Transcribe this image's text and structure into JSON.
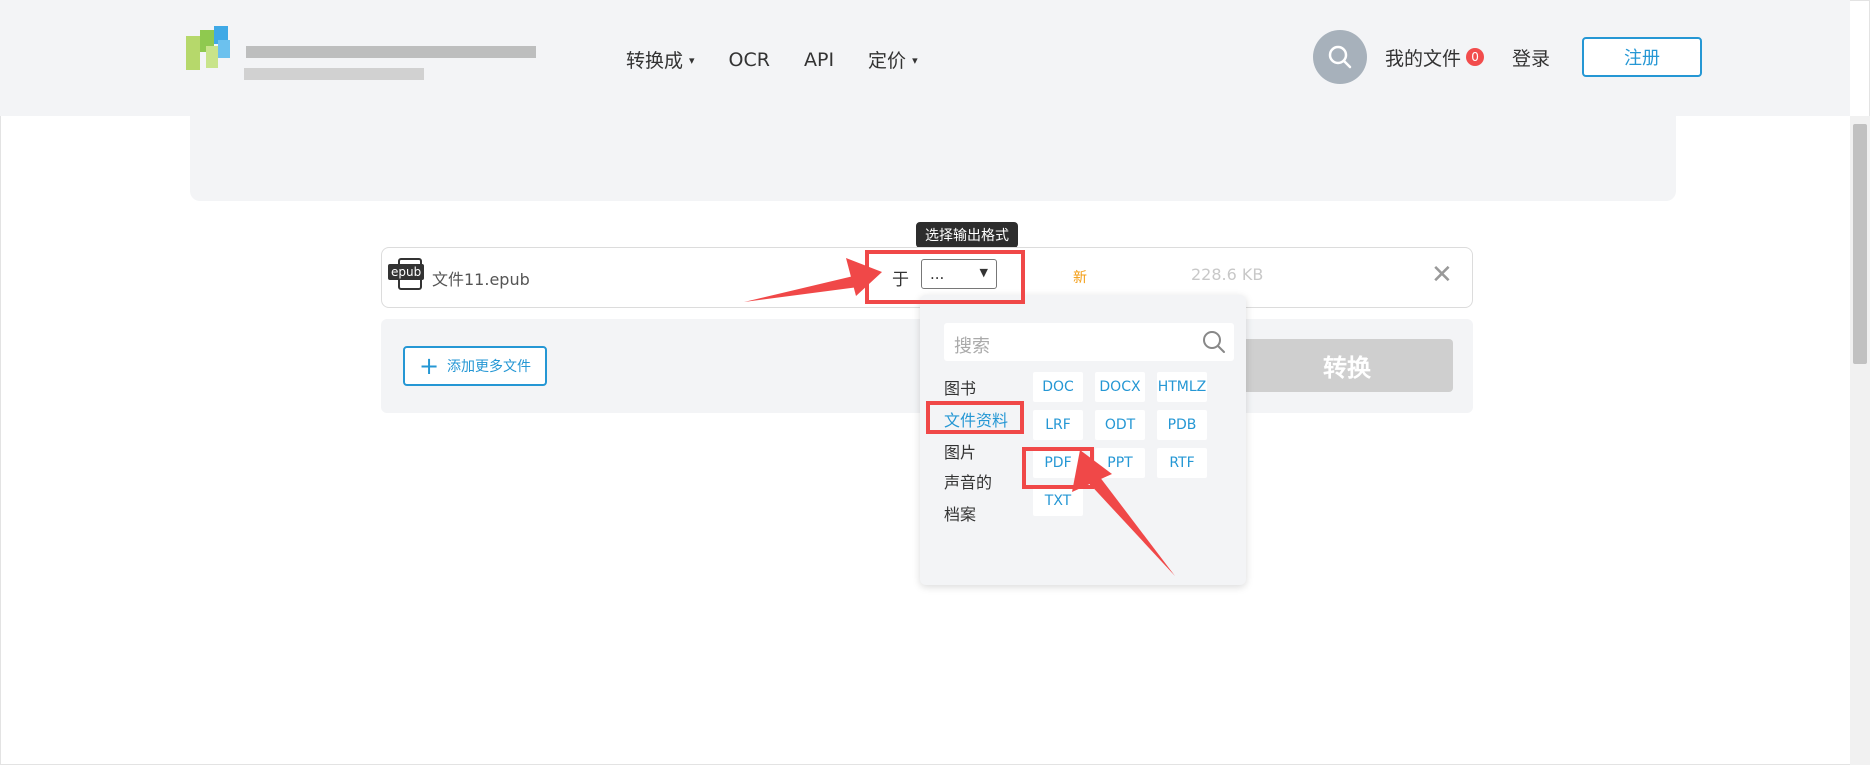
{
  "nav": {
    "items": [
      {
        "label": "转换成",
        "dropdown": true
      },
      {
        "label": "OCR",
        "dropdown": false
      },
      {
        "label": "API",
        "dropdown": false
      },
      {
        "label": "定价",
        "dropdown": true
      }
    ],
    "my_files": "我的文件",
    "my_files_count": "0",
    "login": "登录",
    "register": "注册"
  },
  "file": {
    "type_tag": "epub",
    "name": "文件11.epub",
    "to_label": "于",
    "selected_format": "...",
    "status": "新",
    "size": "228.6 KB",
    "remove": "✕"
  },
  "tooltip": "选择输出格式",
  "actions": {
    "add_more": "添加更多文件",
    "convert": "转换"
  },
  "dropdown": {
    "search_placeholder": "搜索",
    "categories": [
      {
        "label": "图书"
      },
      {
        "label": "文件资料",
        "active": true
      },
      {
        "label": "图片"
      },
      {
        "label": "声音的"
      },
      {
        "label": "档案"
      }
    ],
    "formats": [
      "DOC",
      "DOCX",
      "HTMLZ",
      "LRF",
      "ODT",
      "PDB",
      "PDF",
      "PPT",
      "RTF",
      "TXT"
    ]
  },
  "colors": {
    "accent": "#2597d4",
    "highlight": "#f04848",
    "badge": "#f24c4c"
  }
}
